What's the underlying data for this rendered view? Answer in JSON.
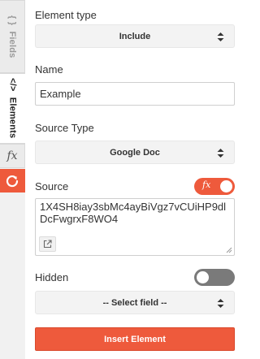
{
  "tabs": {
    "fields": {
      "label": "Fields",
      "symbol": "{ }"
    },
    "elements": {
      "label": "Elements",
      "symbol": "</>"
    },
    "functions": {
      "symbol": "fx"
    },
    "refresh": {
      "icon": "refresh-icon"
    }
  },
  "form": {
    "element_type": {
      "label": "Element type",
      "value": "Include"
    },
    "name": {
      "label": "Name",
      "value": "Example"
    },
    "source_type": {
      "label": "Source Type",
      "value": "Google Doc"
    },
    "source": {
      "label": "Source",
      "value": "1X4SH8iay3sbMc4ayBiVgz7vCUiHP9dlDcFwgrxF8WO4",
      "formula_toggle_text": "fx",
      "formula_toggle_on": true
    },
    "hidden": {
      "label": "Hidden",
      "toggle_on": false,
      "select_placeholder": "-- Select field --"
    },
    "insert_button": "Insert Element"
  },
  "colors": {
    "accent": "#ee5a3c",
    "toggle_off": "#7a7a7a",
    "select_bg": "#f3f3f3"
  }
}
